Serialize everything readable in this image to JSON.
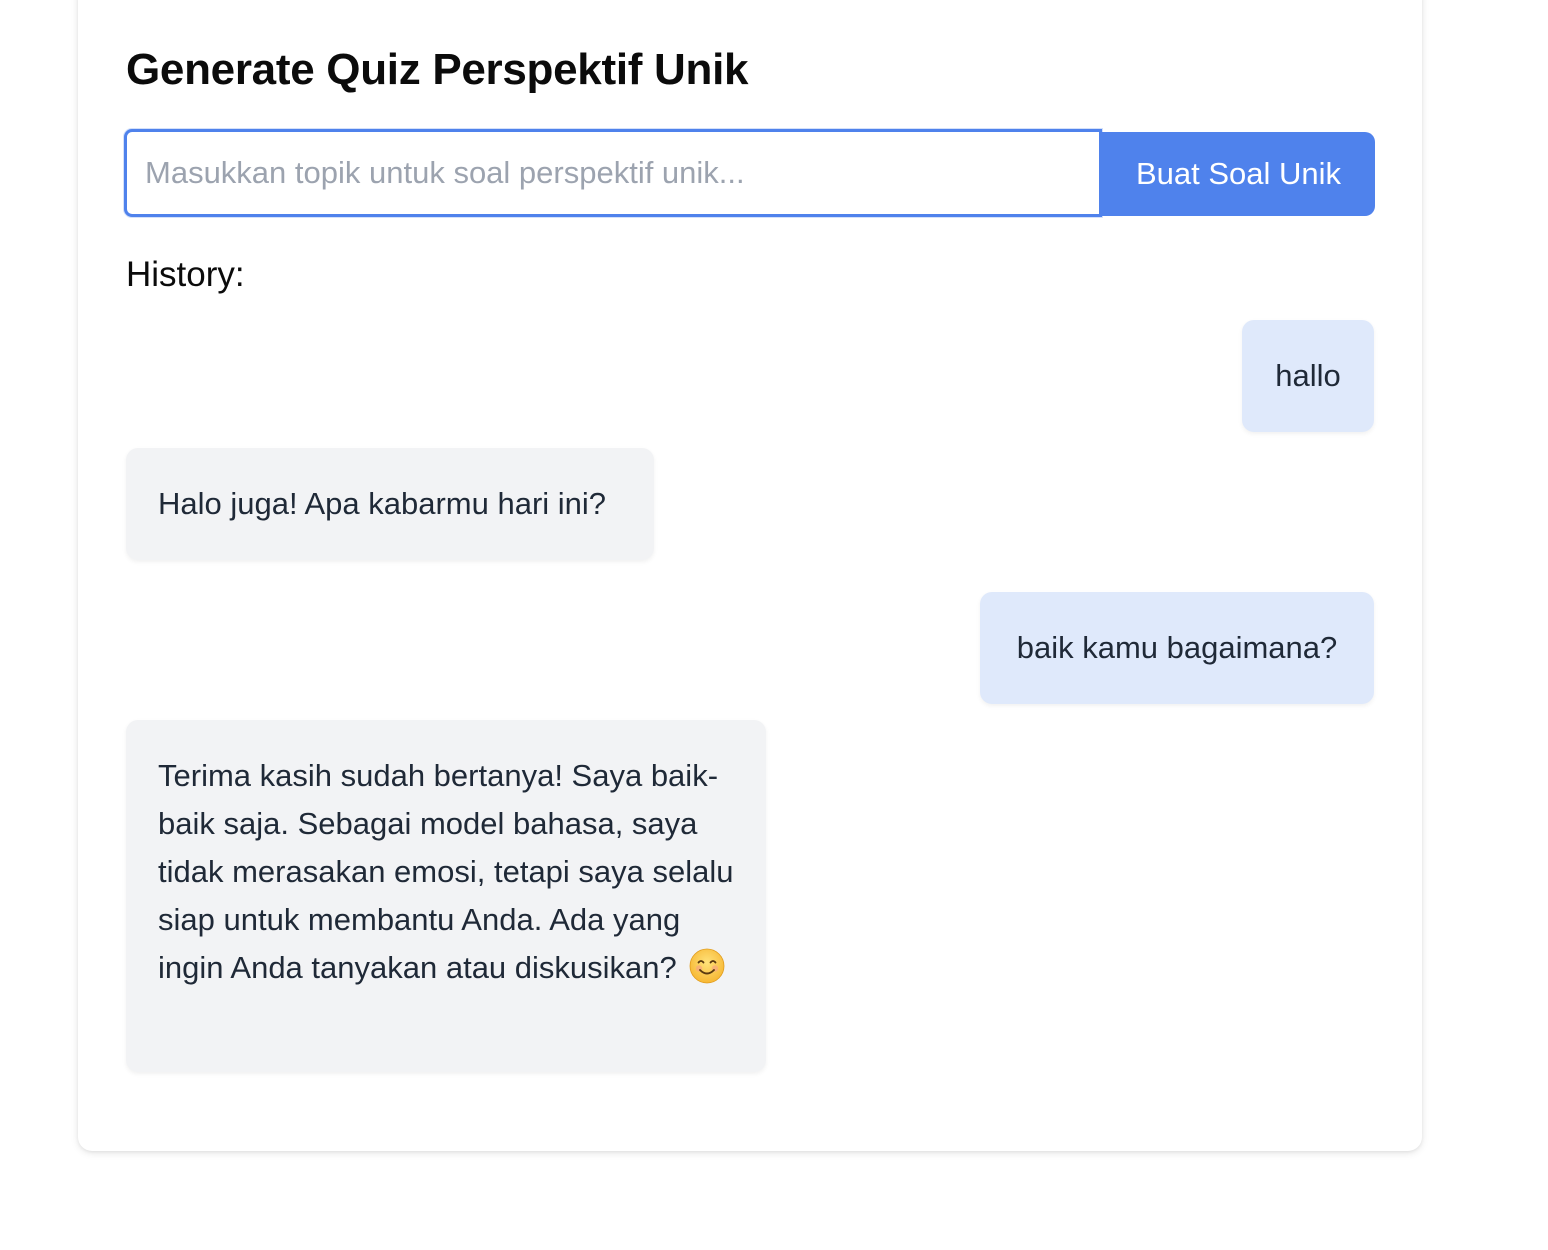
{
  "page": {
    "title": "Generate Quiz Perspektif Unik"
  },
  "form": {
    "input_value": "",
    "input_placeholder": "Masukkan topik untuk soal perspektif unik...",
    "submit_label": "Buat Soal Unik"
  },
  "history": {
    "heading": "History:",
    "messages": [
      {
        "role": "user",
        "text": "hallo"
      },
      {
        "role": "assistant",
        "text": "Halo juga! Apa kabarmu hari ini?"
      },
      {
        "role": "user",
        "text": "baik kamu bagaimana?"
      },
      {
        "role": "assistant",
        "text": "Terima kasih sudah bertanya! Saya baik-baik saja. Sebagai model bahasa, saya tidak merasakan emosi, tetapi saya selalu siap untuk membantu Anda. Ada yang ingin Anda tanyakan atau diskusikan?",
        "emoji": "smiling-face-icon"
      }
    ]
  },
  "colors": {
    "accent": "#4f82ec",
    "user_bubble": "#dfe9fb",
    "assistant_bubble": "#f2f3f5",
    "text": "#1f2937"
  }
}
